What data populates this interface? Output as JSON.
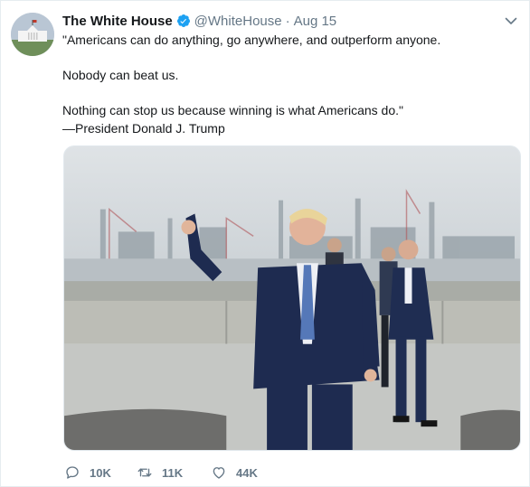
{
  "author": {
    "display_name": "The White House",
    "handle": "@WhiteHouse",
    "date": "Aug 15",
    "separator": "·",
    "verified_icon": "verified-badge-icon"
  },
  "tweet": {
    "line1": "\"Americans can do anything, go anywhere, and outperform anyone.",
    "line2": "Nobody can beat us.",
    "line3": "Nothing can stop us because winning is what Americans do.\"",
    "line4": "—President Donald J. Trump"
  },
  "actions": {
    "reply_count": "10K",
    "retweet_count": "11K",
    "like_count": "44K",
    "reply_icon": "reply-icon",
    "retweet_icon": "retweet-icon",
    "like_icon": "heart-icon"
  },
  "menu_icon": "chevron-down-icon",
  "colors": {
    "verified_blue": "#1da1f2",
    "meta_gray": "#657786",
    "text": "#14171a"
  }
}
